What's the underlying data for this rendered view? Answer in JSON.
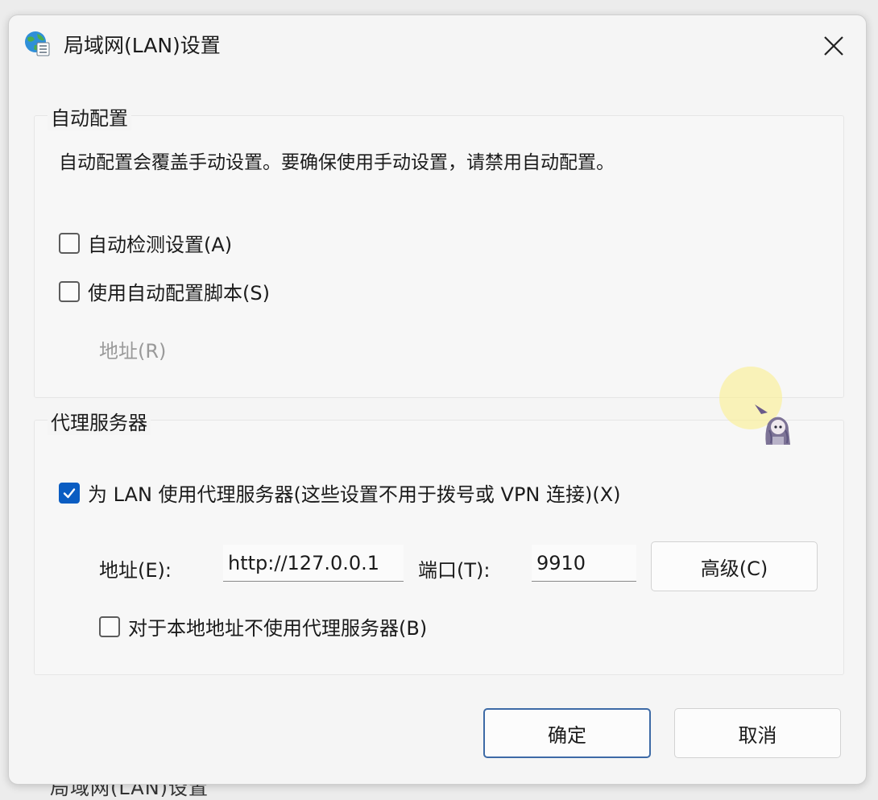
{
  "background_window": {
    "title": "局域网(LAN)设置"
  },
  "dialog": {
    "title": "局域网(LAN)设置",
    "close_icon": "close-icon",
    "app_icon": "globe-settings-icon"
  },
  "auto_config": {
    "group_label": "自动配置",
    "description": "自动配置会覆盖手动设置。要确保使用手动设置，请禁用自动配置。",
    "auto_detect": {
      "label": "自动检测设置(A)",
      "checked": false
    },
    "use_script": {
      "label": "使用自动配置脚本(S)",
      "checked": false
    },
    "address_label": "地址(R)"
  },
  "proxy": {
    "group_label": "代理服务器",
    "use_proxy": {
      "label": "为 LAN 使用代理服务器(这些设置不用于拨号或 VPN 连接)(X)",
      "checked": true
    },
    "address_label": "地址(E):",
    "address_value": "http://127.0.0.1",
    "port_label": "端口(T):",
    "port_value": "9910",
    "advanced_label": "高级(C)",
    "bypass_local": {
      "label": "对于本地地址不使用代理服务器(B)",
      "checked": false
    }
  },
  "buttons": {
    "ok": "确定",
    "cancel": "取消"
  },
  "colors": {
    "accent": "#0a5dc2",
    "dialog_bg": "#f5f5f5",
    "disabled_text": "#9a9a9a"
  }
}
